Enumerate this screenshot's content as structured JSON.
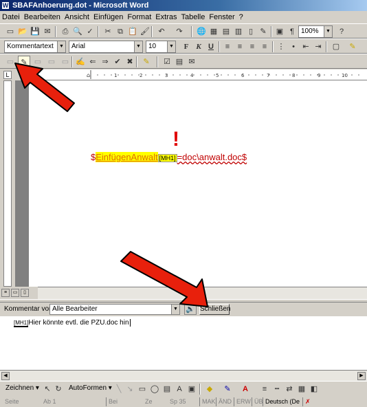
{
  "window": {
    "title": "SBAFAnhoerung.dot - Microsoft Word"
  },
  "menu": [
    "Datei",
    "Bearbeiten",
    "Ansicht",
    "Einfügen",
    "Format",
    "Extras",
    "Tabelle",
    "Fenster",
    "?"
  ],
  "formatting": {
    "style": "Kommentartext",
    "font": "Arial",
    "size": "10",
    "zoom": "100%"
  },
  "document": {
    "field_start": "$",
    "field_name": "EinfügenAnwalt",
    "comment_marker": "[MH1]",
    "field_rest": "=doc\\anwalt.doc$",
    "exclamation": "!"
  },
  "comments": {
    "label": "Kommentar von:",
    "filter": "Alle Bearbeiter",
    "close_button": "Schließen",
    "marker": "[MH1]",
    "text": "Hier könnte evtl. die PZU.doc hin"
  },
  "drawing": {
    "draw_label": "Zeichnen",
    "autoshapes_label": "AutoFormen"
  },
  "status": {
    "page": "Seite",
    "section": "Ab 1",
    "at": "Bei",
    "line": "Ze",
    "col": "Sp 35",
    "mak": "MAK",
    "aen": "ÄND",
    "erw": "ERW",
    "ub": "ÜB",
    "language": "Deutsch (De"
  },
  "colors": {
    "arrow": "#e8200c",
    "title_start": "#0a246a",
    "title_end": "#a6caf0"
  }
}
